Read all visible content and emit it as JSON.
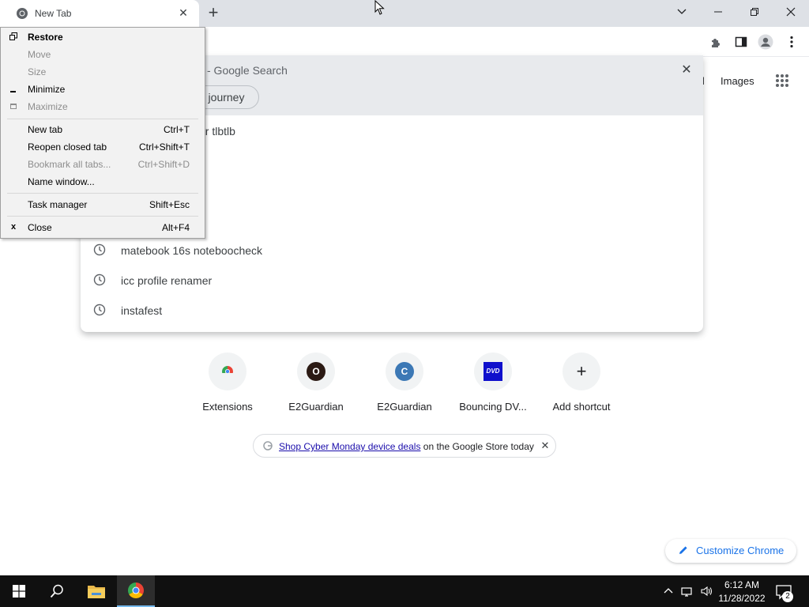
{
  "browser": {
    "tab": {
      "title": "New Tab",
      "close_symbol": "✕"
    },
    "new_tab_symbol": "+"
  },
  "omnibox": {
    "search_suggestion": "- Google Search",
    "chip_label": "r journey",
    "partial_item": "er tlbtlb",
    "history_items": [
      {
        "text": "matebook 16s noteboocheck"
      },
      {
        "text": "icc profile renamer"
      },
      {
        "text": "instafest"
      }
    ]
  },
  "header_links": {
    "gmail_partial": "il",
    "images": "Images"
  },
  "shortcuts": [
    {
      "label": "Extensions",
      "icon": "chrome-extensions-icon"
    },
    {
      "label": "E2Guardian",
      "icon": "letter-o-icon",
      "letter": "O",
      "color": "#2b1a14"
    },
    {
      "label": "E2Guardian",
      "icon": "letter-c-icon",
      "letter": "C",
      "color": "#3c78b5"
    },
    {
      "label": "Bouncing DV...",
      "icon": "dvd-logo-icon",
      "letter": "DVD",
      "color": "#1010cc"
    },
    {
      "label": "Add shortcut",
      "icon": "plus-icon",
      "letter": "+"
    }
  ],
  "promo": {
    "link_text": "Shop Cyber Monday device deals",
    "rest_text": " on the Google Store today",
    "close_symbol": "✕"
  },
  "customize": {
    "label": "Customize Chrome"
  },
  "system_menu": {
    "items": [
      {
        "label": "Restore",
        "shortcut": "",
        "icon": "restore-icon",
        "disabled": false,
        "bold": true
      },
      {
        "label": "Move",
        "shortcut": "",
        "icon": "",
        "disabled": true
      },
      {
        "label": "Size",
        "shortcut": "",
        "icon": "",
        "disabled": true
      },
      {
        "label": "Minimize",
        "shortcut": "",
        "icon": "minimize-icon",
        "disabled": false
      },
      {
        "label": "Maximize",
        "shortcut": "",
        "icon": "maximize-icon",
        "disabled": true
      },
      {
        "label": "New tab",
        "shortcut": "Ctrl+T",
        "disabled": false
      },
      {
        "label": "Reopen closed tab",
        "shortcut": "Ctrl+Shift+T",
        "disabled": false
      },
      {
        "label": "Bookmark all tabs...",
        "shortcut": "Ctrl+Shift+D",
        "disabled": true
      },
      {
        "label": "Name window...",
        "shortcut": "",
        "disabled": false
      },
      {
        "label": "Task manager",
        "shortcut": "Shift+Esc",
        "disabled": false
      },
      {
        "label": "Close",
        "shortcut": "Alt+F4",
        "icon": "close-icon",
        "disabled": false
      }
    ],
    "close_icon_symbol": "x"
  },
  "taskbar": {
    "time": "6:12 AM",
    "date": "11/28/2022",
    "notification_count": "2"
  },
  "colors": {
    "accent": "#1a73e8",
    "taskbar": "#101010",
    "menu_bg": "#f2f2f2"
  }
}
